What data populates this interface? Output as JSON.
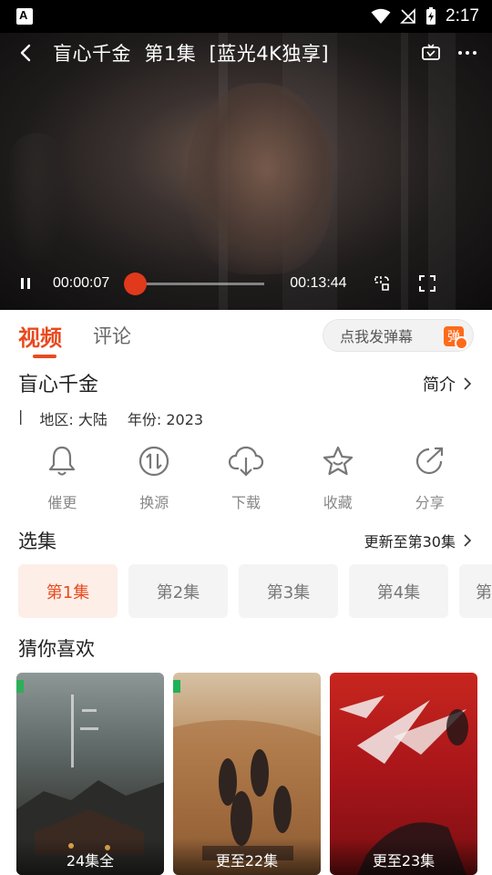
{
  "status_bar": {
    "time": "2:17"
  },
  "player": {
    "title": "盲心千金  第1集  [蓝光4K独享]",
    "current_time": "00:00:07",
    "duration": "00:13:44",
    "progress": 0.0085
  },
  "tabs": [
    {
      "label": "视频",
      "active": true
    },
    {
      "label": "评论",
      "active": false
    }
  ],
  "danmu": {
    "label": "点我发弹幕",
    "badge": "弹"
  },
  "show": {
    "title": "盲心千金",
    "intro_label": "简介",
    "sep": "|",
    "region": "地区: 大陆",
    "year": "年份: 2023"
  },
  "actions": [
    {
      "label": "催更",
      "icon": "bell-icon"
    },
    {
      "label": "换源",
      "icon": "switch-source-icon"
    },
    {
      "label": "下载",
      "icon": "download-icon"
    },
    {
      "label": "收藏",
      "icon": "star-icon"
    },
    {
      "label": "分享",
      "icon": "share-icon"
    }
  ],
  "episodes": {
    "title": "选集",
    "update": "更新至第30集",
    "items": [
      "第1集",
      "第2集",
      "第3集",
      "第4集",
      "第"
    ]
  },
  "recommend": {
    "title": "猜你喜欢",
    "cards": [
      {
        "caption": "24集全"
      },
      {
        "caption": "更至22集"
      },
      {
        "caption": "更至23集"
      }
    ]
  },
  "colors": {
    "accent": "#e84a1f"
  }
}
